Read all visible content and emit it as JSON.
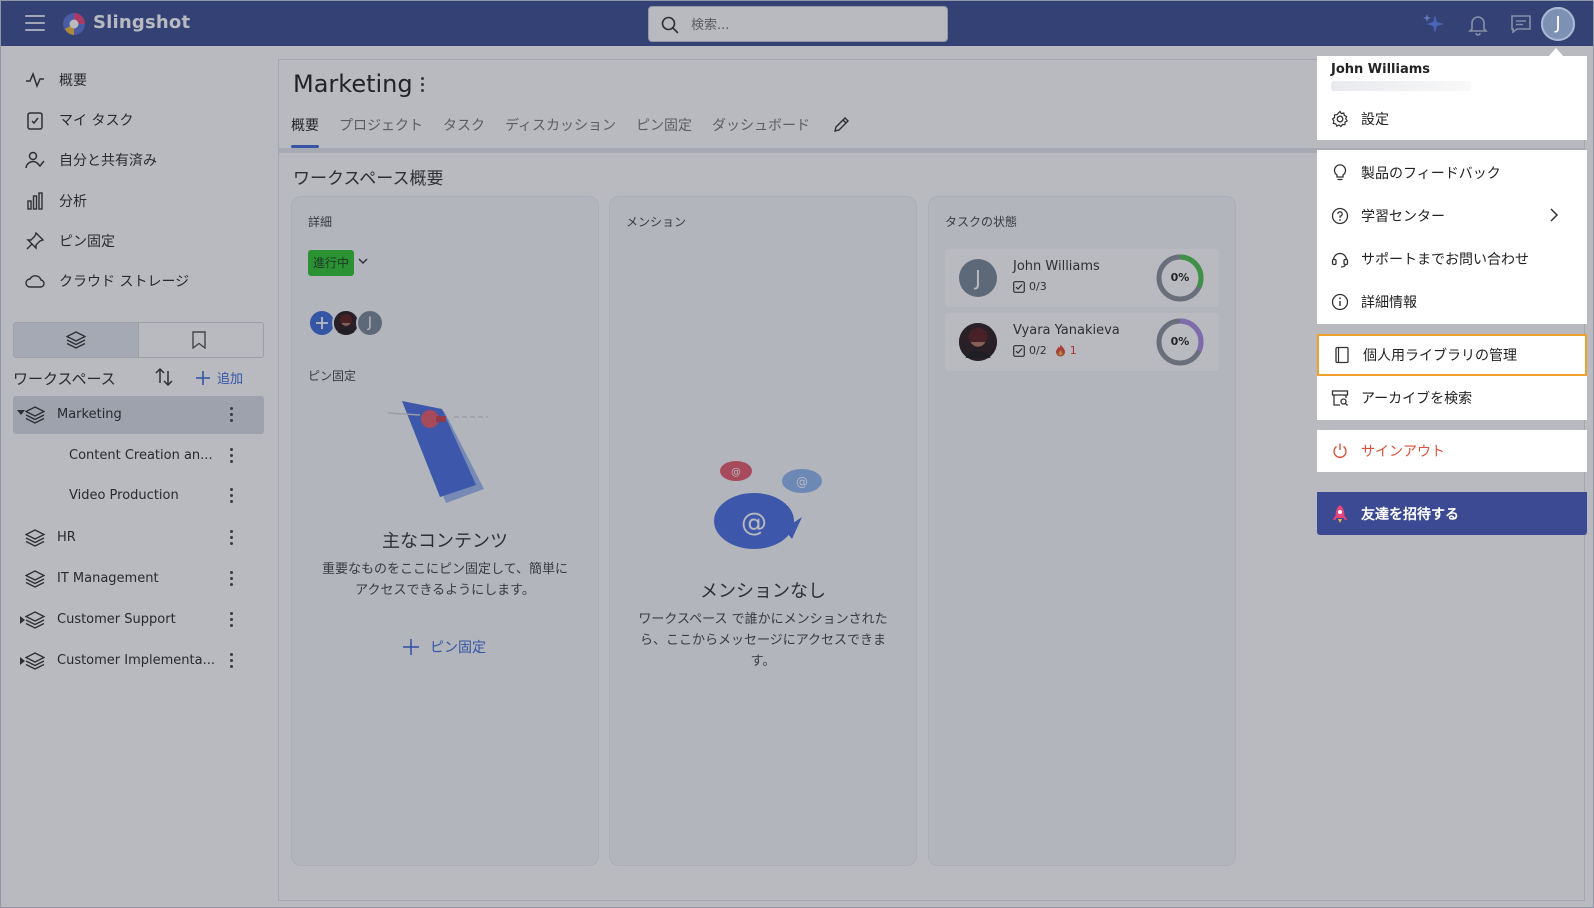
{
  "app": {
    "brand": "Slingshot"
  },
  "search": {
    "placeholder": "検索..."
  },
  "user": {
    "initial": "J",
    "name": "John Williams"
  },
  "sidebar": {
    "nav": [
      {
        "label": "概要",
        "icon": "activity-icon"
      },
      {
        "label": "マイ タスク",
        "icon": "clipboard-check-icon"
      },
      {
        "label": "自分と共有済み",
        "icon": "user-check-icon"
      },
      {
        "label": "分析",
        "icon": "bar-chart-icon"
      },
      {
        "label": "ピン固定",
        "icon": "pin-icon"
      },
      {
        "label": "クラウド ストレージ",
        "icon": "cloud-icon"
      }
    ],
    "workspaces_title": "ワークスペース",
    "add_label": "追加",
    "workspaces": [
      {
        "label": "Marketing"
      },
      {
        "label": "Content Creation an..."
      },
      {
        "label": "Video Production"
      },
      {
        "label": "HR"
      },
      {
        "label": "IT Management"
      },
      {
        "label": "Customer Support"
      },
      {
        "label": "Customer Implementa..."
      }
    ]
  },
  "main": {
    "title": "Marketing",
    "tabs": [
      "概要",
      "プロジェクト",
      "タスク",
      "ディスカッション",
      "ピン固定",
      "ダッシュボード"
    ],
    "overview_title": "ワークスペース概要",
    "details": {
      "title": "詳細",
      "status": "進行中",
      "member_initial": "J",
      "pinned_label": "ピン固定",
      "empty_title": "主なコンテンツ",
      "empty_text": "重要なものをここにピン固定して、簡単にアクセスできるようにします。",
      "pin_action": "ピン固定"
    },
    "mentions": {
      "title": "メンション",
      "empty_title": "メンションなし",
      "empty_text": "ワークスペース で誰かにメンションされたら、ここからメッセージにアクセスできます。"
    },
    "task_status": {
      "title": "タスクの状態",
      "rows": [
        {
          "name": "John Williams",
          "initial": "J",
          "count": "0/3",
          "percent": "0%",
          "progress": 0.0,
          "ring_color": "#4cc34c"
        },
        {
          "name": "Vyara Yanakieva",
          "initial": "",
          "count": "0/2",
          "overdue": "1",
          "percent": "0%",
          "progress": 0.0,
          "ring_color": "#a88be0"
        }
      ]
    }
  },
  "menu": {
    "items": [
      {
        "label": "設定",
        "icon": "gear-icon"
      },
      {
        "label": "製品のフィードバック",
        "icon": "lightbulb-icon"
      },
      {
        "label": "学習センター",
        "icon": "help-circle-icon"
      },
      {
        "label": "サポートまでお問い合わせ",
        "icon": "headset-icon"
      },
      {
        "label": "詳細情報",
        "icon": "info-icon"
      },
      {
        "label": "個人用ライブラリの管理",
        "icon": "book-icon"
      },
      {
        "label": "アーカイブを検索",
        "icon": "archive-search-icon"
      },
      {
        "label": "サインアウト",
        "icon": "power-icon"
      }
    ],
    "invite": "友達を招待する"
  },
  "colors": {
    "topbar": "#3b4d8f",
    "accent": "#3f6bd8",
    "highlight": "#f0a12a",
    "status_green": "#2fc42f",
    "signout": "#e0523c",
    "invite_bg": "#3b4a92"
  }
}
